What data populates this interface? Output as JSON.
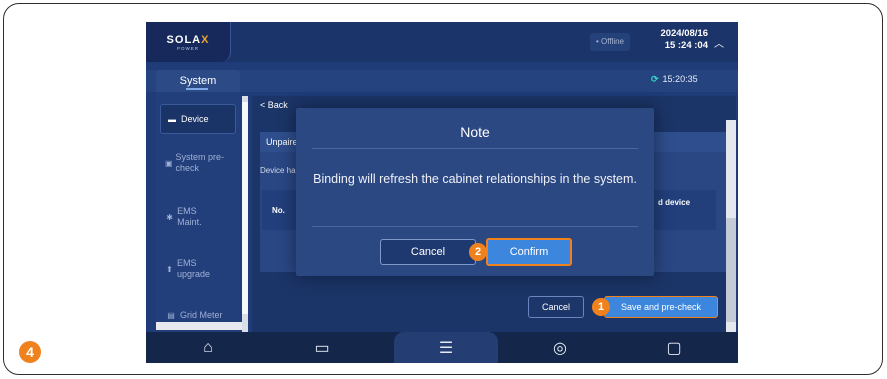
{
  "step_badges": {
    "save": "1",
    "confirm": "2",
    "corner": "4"
  },
  "topbar": {
    "logo": "SOLA",
    "logo_x": "X",
    "logo_sub": "POWER",
    "status": "• Offline",
    "date": "2024/08/16",
    "time": "15 :24 :04",
    "collapse_icon": "chevron-up-icon"
  },
  "tabs": {
    "system": "System",
    "sync_time": "15:20:35",
    "sync_icon": "refresh-icon"
  },
  "sidebar": {
    "items": [
      {
        "label": "Device",
        "icon": "device-icon",
        "active": true
      },
      {
        "label": "System pre-check",
        "icon": "precheck-icon",
        "active": false
      },
      {
        "label": "EMS Maint.",
        "icon": "wrench-icon",
        "active": false
      },
      {
        "label": "EMS upgrade",
        "icon": "upgrade-icon",
        "active": false
      },
      {
        "label": "Grid Meter",
        "icon": "meter-icon",
        "active": false
      }
    ]
  },
  "content": {
    "back": "< Back",
    "section": "Unpaired",
    "hint": "Device ha",
    "col_no": "No.",
    "col_device": "d device",
    "cancel": "Cancel",
    "save": "Save and pre-check"
  },
  "modal": {
    "title": "Note",
    "message": "Binding will refresh the cabinet relationships in the system.",
    "cancel": "Cancel",
    "confirm": "Confirm"
  },
  "bottom_nav": [
    {
      "icon": "home-icon",
      "glyph": "⌂",
      "active": false
    },
    {
      "icon": "chart-icon",
      "glyph": "▭",
      "active": false
    },
    {
      "icon": "server-icon",
      "glyph": "☰",
      "active": true
    },
    {
      "icon": "settings-icon",
      "glyph": "◎",
      "active": false
    },
    {
      "icon": "battery-icon",
      "glyph": "▢",
      "active": false
    }
  ],
  "colors": {
    "accent_orange": "#f0821e",
    "button_blue": "#3d86de",
    "bg_dark": "#1f3c78"
  }
}
